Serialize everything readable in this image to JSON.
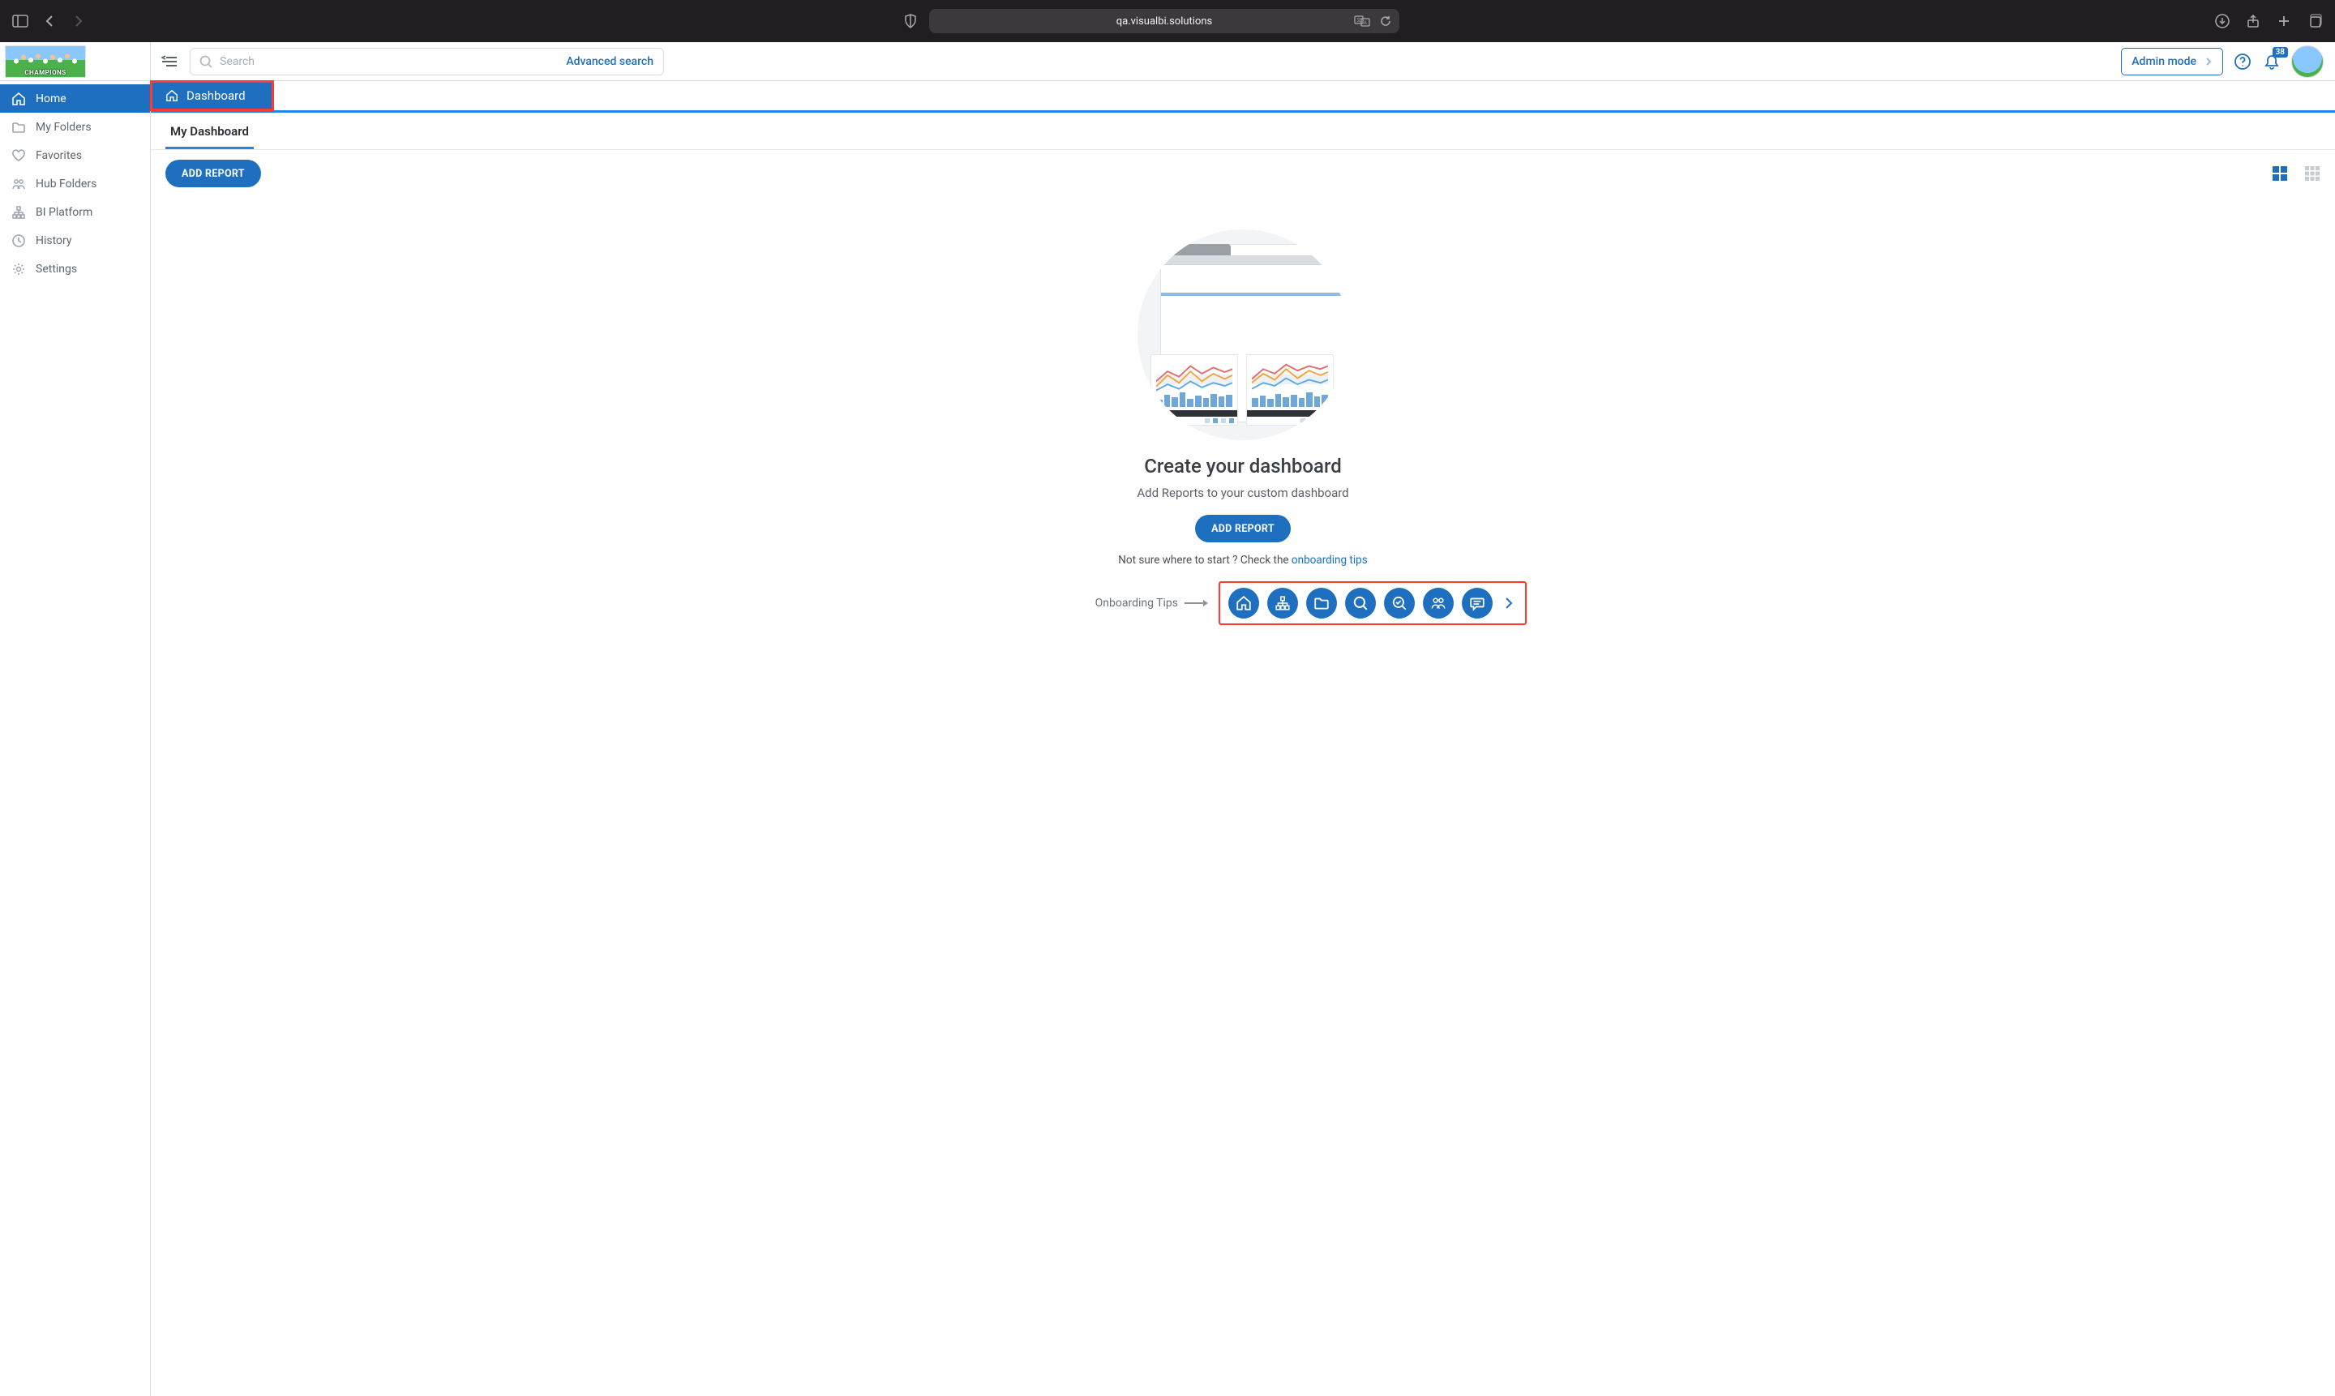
{
  "browser": {
    "url": "qa.visualbi.solutions"
  },
  "sidebar": {
    "items": [
      {
        "icon": "home-icon",
        "label": "Home",
        "active": true
      },
      {
        "icon": "folder-icon",
        "label": "My Folders"
      },
      {
        "icon": "heart-icon",
        "label": "Favorites"
      },
      {
        "icon": "people-icon",
        "label": "Hub Folders"
      },
      {
        "icon": "sitemap-icon",
        "label": "BI Platform"
      },
      {
        "icon": "clock-icon",
        "label": "History"
      },
      {
        "icon": "gear-icon",
        "label": "Settings"
      }
    ]
  },
  "topbar": {
    "search_placeholder": "Search",
    "advanced": "Advanced search",
    "admin_mode": "Admin mode",
    "notification_count": "38"
  },
  "breadcrumb": {
    "label": "Dashboard"
  },
  "subtabs": [
    {
      "label": "My Dashboard",
      "active": true
    }
  ],
  "toolbar": {
    "add_report": "ADD REPORT"
  },
  "empty": {
    "title": "Create your dashboard",
    "subtitle": "Add Reports to your custom dashboard",
    "button": "ADD REPORT",
    "hint_prefix": "Not sure where to start ? Check the ",
    "hint_link": "onboarding tips"
  },
  "onboarding": {
    "label": "Onboarding Tips",
    "buttons": [
      {
        "icon": "home-icon"
      },
      {
        "icon": "sitemap-icon"
      },
      {
        "icon": "folder-icon"
      },
      {
        "icon": "search-icon"
      },
      {
        "icon": "search-check-icon"
      },
      {
        "icon": "people-icon"
      },
      {
        "icon": "chat-icon"
      }
    ]
  }
}
